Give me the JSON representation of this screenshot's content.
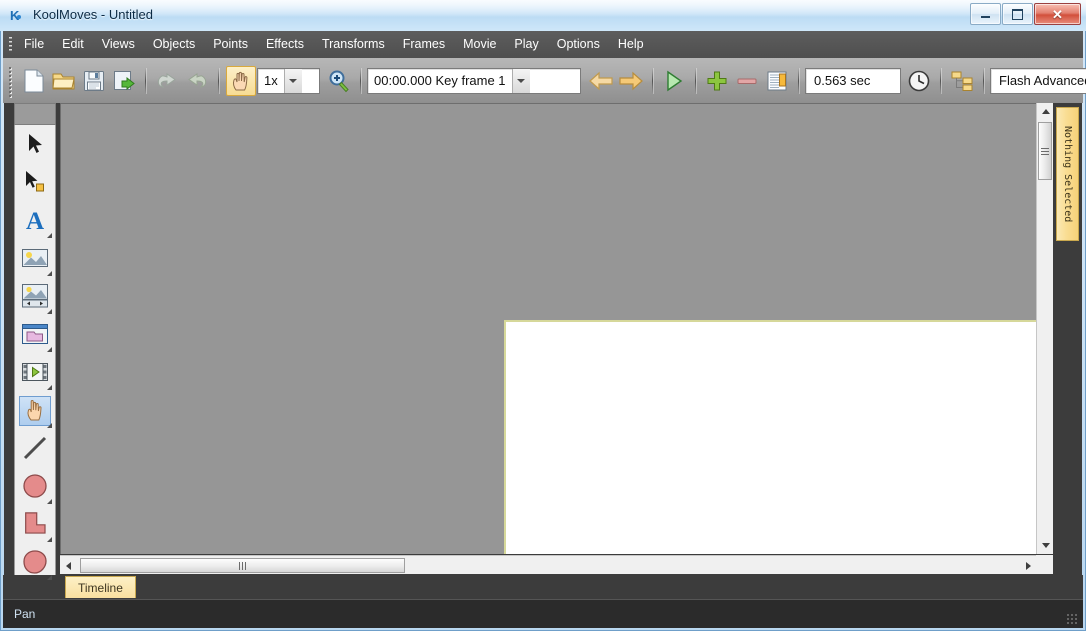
{
  "window": {
    "title": "KoolMoves - Untitled",
    "app_icon": "koolmoves-logo-icon",
    "controls": {
      "minimize": "minimize-button",
      "maximize": "maximize-button",
      "close": "close-button",
      "close_glyph": "✕"
    }
  },
  "menubar": {
    "items": [
      {
        "label": "File"
      },
      {
        "label": "Edit"
      },
      {
        "label": "Views"
      },
      {
        "label": "Objects"
      },
      {
        "label": "Points"
      },
      {
        "label": "Effects"
      },
      {
        "label": "Transforms"
      },
      {
        "label": "Frames"
      },
      {
        "label": "Movie"
      },
      {
        "label": "Play"
      },
      {
        "label": "Options"
      },
      {
        "label": "Help"
      }
    ]
  },
  "toolbar": {
    "new_label": "new-document",
    "open_label": "open-file",
    "save_label": "save-file",
    "export_label": "export-movie",
    "undo_label": "undo",
    "redo_label": "redo",
    "pan_label": "pan-tool",
    "zoom_value": "1x",
    "zoom_tool_label": "zoom-tool",
    "frame_value": "00:00.000  Key frame 1",
    "prev_frame_label": "previous-frame",
    "next_frame_label": "next-frame",
    "play_label": "play-movie",
    "add_frame_label": "add-key-frame",
    "remove_frame_label": "delete-key-frame",
    "frame_props_label": "frame-properties",
    "duration_value": "0.563 sec",
    "timing_label": "timing-options",
    "hierarchy_label": "object-hierarchy",
    "export_profile_value": "Flash Advanced"
  },
  "tools": {
    "items": [
      {
        "name": "select-tool",
        "has_submenu": false,
        "selected": false
      },
      {
        "name": "select-points-tool",
        "has_submenu": false,
        "selected": false
      },
      {
        "name": "text-tool",
        "has_submenu": true,
        "selected": false
      },
      {
        "name": "image-tool",
        "has_submenu": true,
        "selected": false
      },
      {
        "name": "sprite-tool",
        "has_submenu": true,
        "selected": false
      },
      {
        "name": "symbol-library-tool",
        "has_submenu": true,
        "selected": false
      },
      {
        "name": "movie-clip-tool",
        "has_submenu": true,
        "selected": false
      },
      {
        "name": "pan-tool",
        "has_submenu": true,
        "selected": true
      },
      {
        "name": "line-tool",
        "has_submenu": false,
        "selected": false
      },
      {
        "name": "ellipse-tool",
        "has_submenu": true,
        "selected": false
      },
      {
        "name": "polygon-tool",
        "has_submenu": true,
        "selected": false
      },
      {
        "name": "freeform-shape-tool",
        "has_submenu": true,
        "selected": false
      }
    ]
  },
  "workspace": {
    "background_color": "#969696",
    "stage_color": "#ffffff",
    "stage_border_color": "#d6d89a"
  },
  "panels": {
    "right_tab_label": "Nothing Selected",
    "bottom_tab_label": "Timeline"
  },
  "statusbar": {
    "message": "Pan"
  }
}
